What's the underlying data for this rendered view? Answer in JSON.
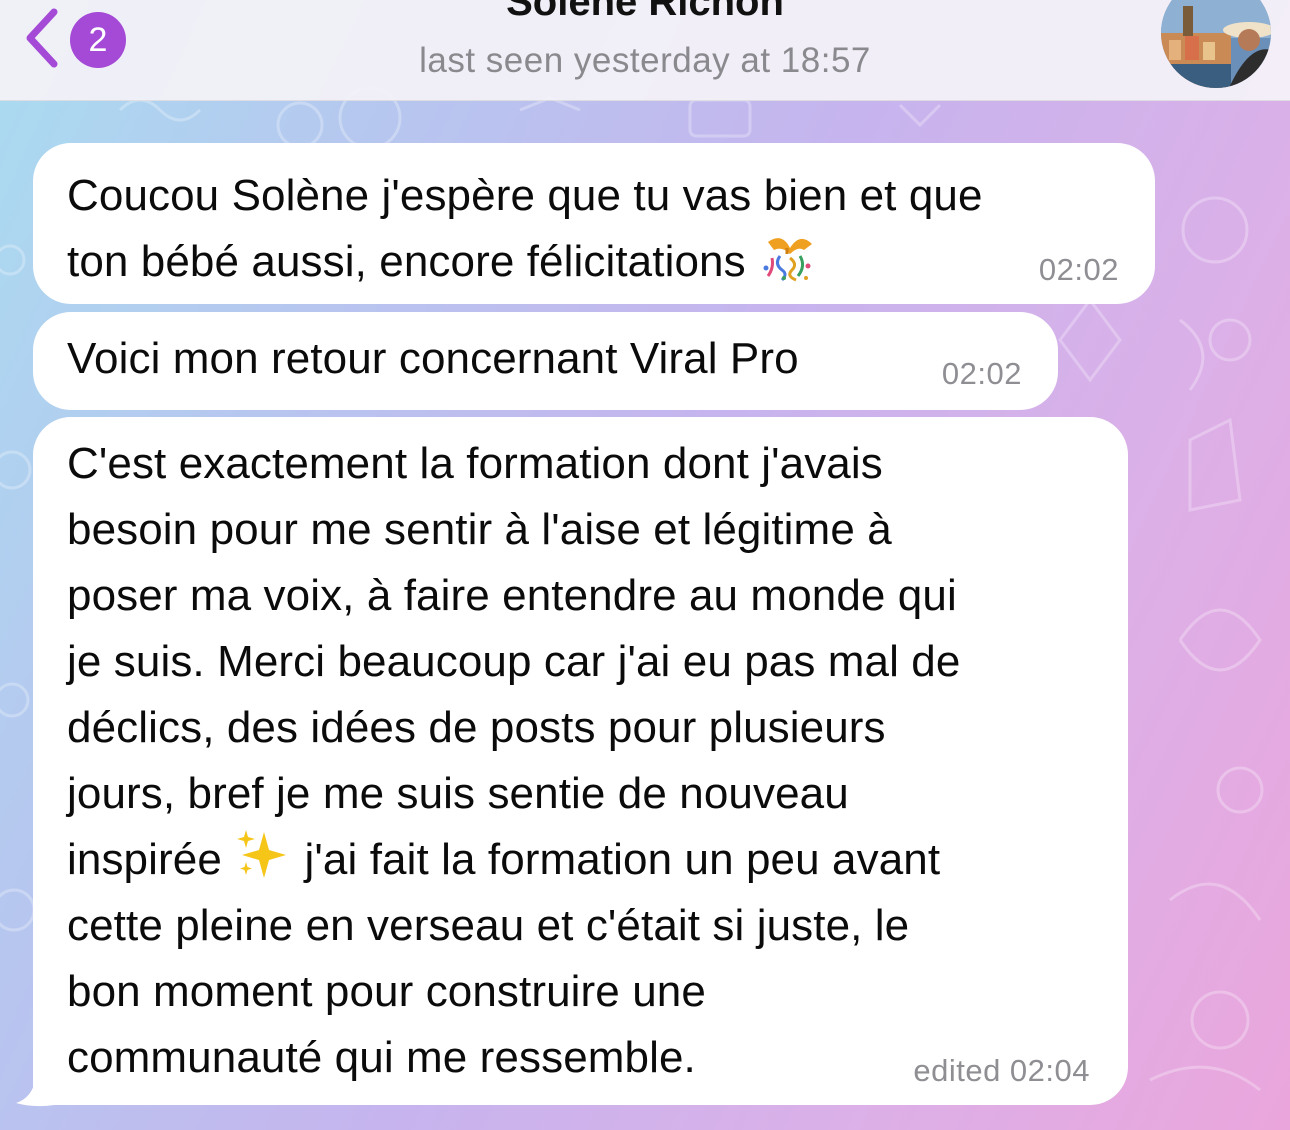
{
  "header": {
    "back_badge_count": "2",
    "contact_name": "Solène Richon",
    "status": "last seen yesterday at 18:57"
  },
  "messages": [
    {
      "text_before_emoji": "Coucou Solène j'espère que tu vas bien et que\nton bébé aussi, encore félicitations ",
      "emoji": "confetti-ball",
      "time": "02:02"
    },
    {
      "text": "Voici mon retour concernant Viral Pro",
      "time": "02:02"
    },
    {
      "text_before_emoji": "C'est exactement la formation dont j'avais\nbesoin pour me sentir à l'aise et légitime à\nposer ma voix, à faire entendre au monde qui\nje suis. Merci beaucoup car j'ai eu pas mal de\ndéclics, des idées de posts pour plusieurs\njours, bref je me suis sentie de nouveau\ninspirée ",
      "emoji": "sparkles",
      "text_after_emoji": " j'ai fait la formation un peu avant\ncette pleine en verseau et c'était si juste, le\nbon moment pour construire une\ncommunauté qui me ressemble.",
      "time": "edited 02:04"
    }
  ],
  "colors": {
    "accent": "#a44ad6",
    "bubble": "#ffffff",
    "timestamp": "#8e8e93"
  }
}
